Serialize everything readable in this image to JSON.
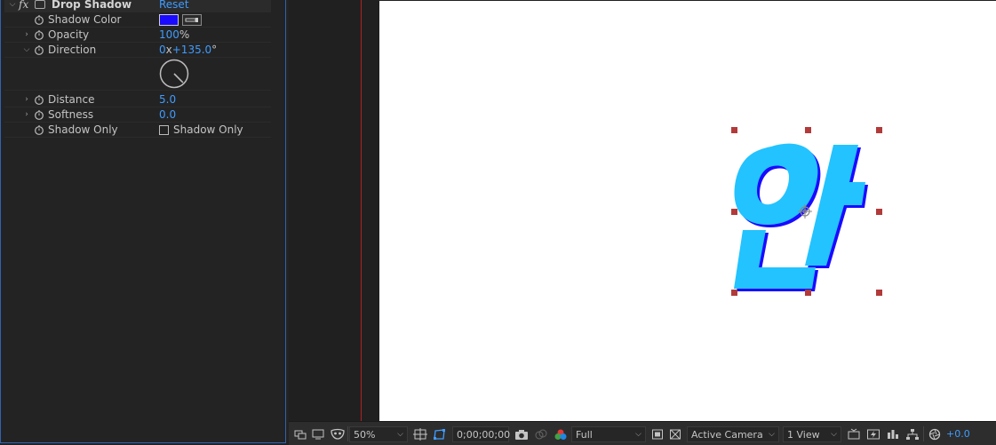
{
  "effect_controls": {
    "effect_name": "Drop Shadow",
    "reset_label": "Reset",
    "fx_label": "fx",
    "properties": {
      "shadow_color": {
        "label": "Shadow Color",
        "color": "#1a0aff"
      },
      "opacity": {
        "label": "Opacity",
        "value": "100",
        "unit": "%"
      },
      "direction": {
        "label": "Direction",
        "revolutions": "0",
        "x_label": "x",
        "angle": "+135.0",
        "unit": "°",
        "angle_degrees": 135
      },
      "distance": {
        "label": "Distance",
        "value": "5.0"
      },
      "softness": {
        "label": "Softness",
        "value": "0.0"
      },
      "shadow_only": {
        "label": "Shadow Only",
        "checkbox_label": "Shadow Only",
        "checked": false
      }
    }
  },
  "composition": {
    "glyph_text": "안",
    "glyph_color": "#22c3ff",
    "shadow_color": "#1a0aff",
    "handle_color": "#b23a3a"
  },
  "viewer_toolbar": {
    "zoom": "50%",
    "timecode": "0;00;00;00",
    "resolution": "Full",
    "camera": "Active Camera",
    "views": "1 View",
    "exposure": "+0.0"
  }
}
